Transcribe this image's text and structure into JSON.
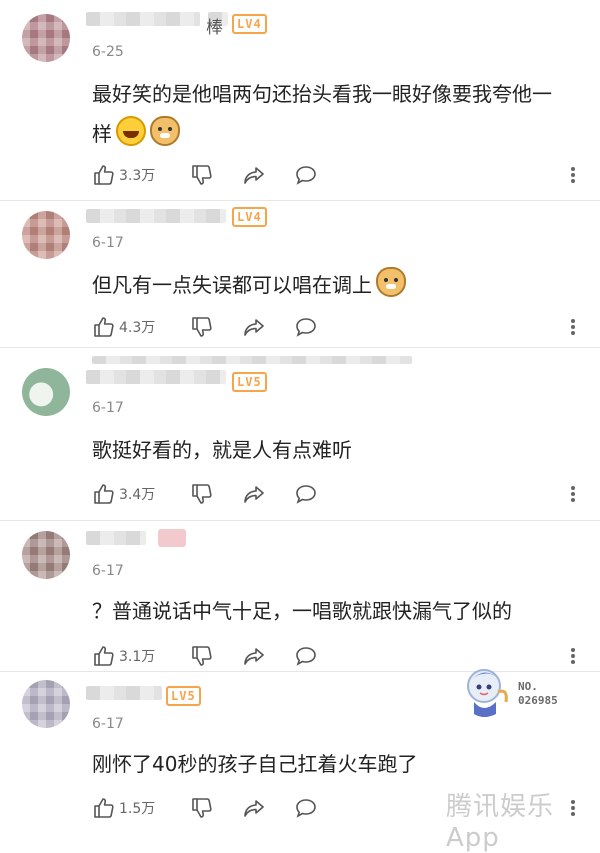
{
  "comments": [
    {
      "name_tail": "棒",
      "level": "LV4",
      "date": "6-25",
      "text": "最好笑的是他唱两句还抬头看我一眼好像要我夸他一样",
      "emojis": [
        "laugh-emoji",
        "doge-emoji"
      ],
      "likes": "3.3万",
      "avatar_color": "#b9888e"
    },
    {
      "name_tail": "",
      "level": "LV4",
      "date": "6-17",
      "text": "但凡有一点失误都可以唱在调上",
      "emojis": [
        "doge-emoji"
      ],
      "likes": "4.3万",
      "avatar_color": "#c58e86"
    },
    {
      "name_tail": "",
      "level": "LV5",
      "date": "6-17",
      "text": "歌挺好看的，就是人有点难听",
      "emojis": [],
      "likes": "3.4万",
      "avatar_color": "#8fb59a"
    },
    {
      "name_tail": "",
      "level": "",
      "date": "6-17",
      "text": "？普通说话中气十足，一唱歌就跟快漏气了似的",
      "emojis": [],
      "likes": "3.1万",
      "avatar_color": "#a68a86"
    },
    {
      "name_tail": "",
      "level": "LV5",
      "date": "6-17",
      "text": "刚怀了40秒的孩子自己扛着火车跑了",
      "emojis": [],
      "likes": "1.5万",
      "avatar_color": "#b9b4c8"
    }
  ],
  "watermark": {
    "number_label": "NO.",
    "number": "026985",
    "brand": "腾讯娱乐App"
  },
  "colors": {
    "level_badge": "#f6a54a",
    "divider": "#e6e6e6"
  }
}
